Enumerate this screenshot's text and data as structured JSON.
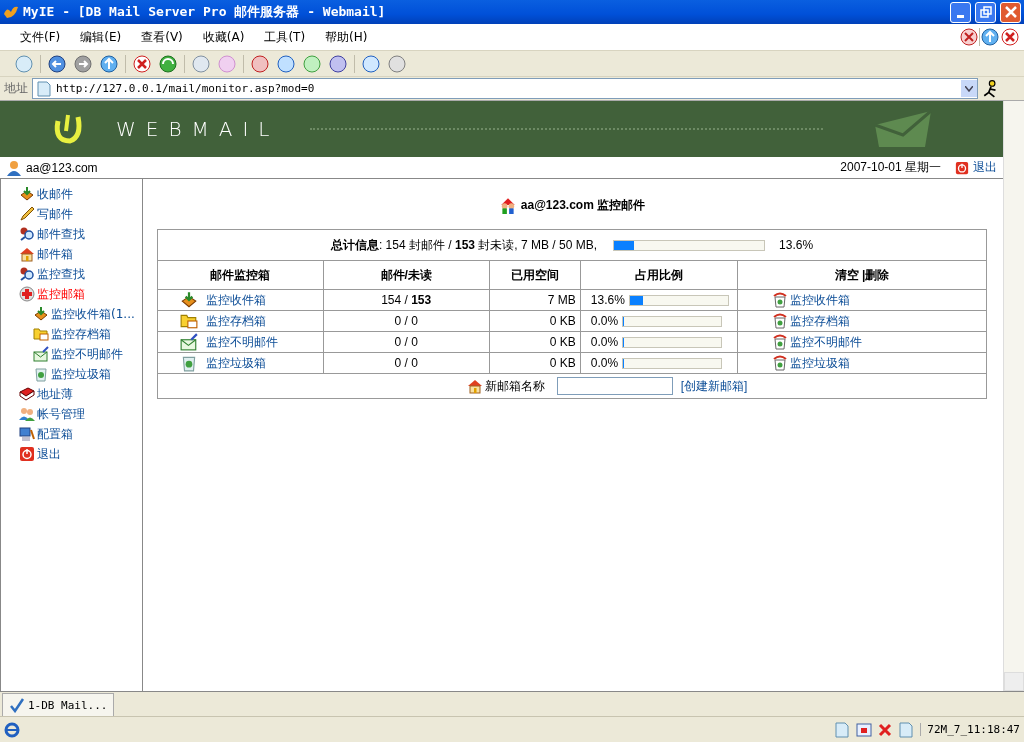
{
  "window": {
    "title": "MyIE - [DB Mail Server Pro 邮件服务器 - Webmail]"
  },
  "menu": [
    "文件(F)",
    "编辑(E)",
    "查看(V)",
    "收藏(A)",
    "工具(T)",
    "帮助(H)"
  ],
  "address": {
    "label": "地址",
    "url": "http://127.0.0.1/mail/monitor.asp?mod=0"
  },
  "banner": {
    "brand": "WEBMAIL"
  },
  "userbar": {
    "user": "aa@123.com",
    "date": "2007-10-01 星期一",
    "logout": "退出"
  },
  "sidebar": {
    "items": [
      {
        "label": "收邮件",
        "selected": false
      },
      {
        "label": "写邮件",
        "selected": false
      },
      {
        "label": "邮件查找",
        "selected": false
      },
      {
        "label": "邮件箱",
        "selected": false
      },
      {
        "label": "监控查找",
        "selected": false
      },
      {
        "label": "监控邮箱",
        "selected": true,
        "children": [
          {
            "label": "监控收件箱(1...",
            "selected": false
          },
          {
            "label": "监控存档箱",
            "selected": false
          },
          {
            "label": "监控不明邮件",
            "selected": false
          },
          {
            "label": "监控垃圾箱",
            "selected": false
          }
        ]
      },
      {
        "label": "地址薄",
        "selected": false
      },
      {
        "label": "帐号管理",
        "selected": false
      },
      {
        "label": "配置箱",
        "selected": false
      },
      {
        "label": "退出",
        "selected": false
      }
    ]
  },
  "main": {
    "title": "aa@123.com 监控邮件",
    "summary": {
      "label": "总计信息",
      "text": ": 154 封邮件 / **153** 封未读, 7 MB / 50 MB,",
      "level": 0.136,
      "reading": "13.6%"
    },
    "columns": [
      "邮件监控箱",
      "邮件/未读",
      "已用空间",
      "占用比例",
      "清空 |删除"
    ],
    "rows": [
      {
        "name": "监控收件箱",
        "counts": "154 / **153**",
        "size": "7 MB",
        "percent": "13.6%",
        "level": 0.136,
        "action": "监控收件箱"
      },
      {
        "name": "监控存档箱",
        "counts": "0 / 0",
        "size": "0 KB",
        "percent": "0.0%",
        "level": 0,
        "action": "监控存档箱"
      },
      {
        "name": "监控不明邮件",
        "counts": "0 / 0",
        "size": "0 KB",
        "percent": "0.0%",
        "level": 0,
        "action": "监控不明邮件"
      },
      {
        "name": "监控垃圾箱",
        "counts": "0 / 0",
        "size": "0 KB",
        "percent": "0.0%",
        "level": 0,
        "action": "监控垃圾箱"
      }
    ],
    "new_mailbox": {
      "label": "新邮箱名称",
      "button": "[创建新邮箱]"
    }
  },
  "tabs": [
    {
      "label": "1-DB Mail...",
      "selected": true
    }
  ],
  "status_bar": {
    "memory_time": "72M_7_11:18:47"
  }
}
